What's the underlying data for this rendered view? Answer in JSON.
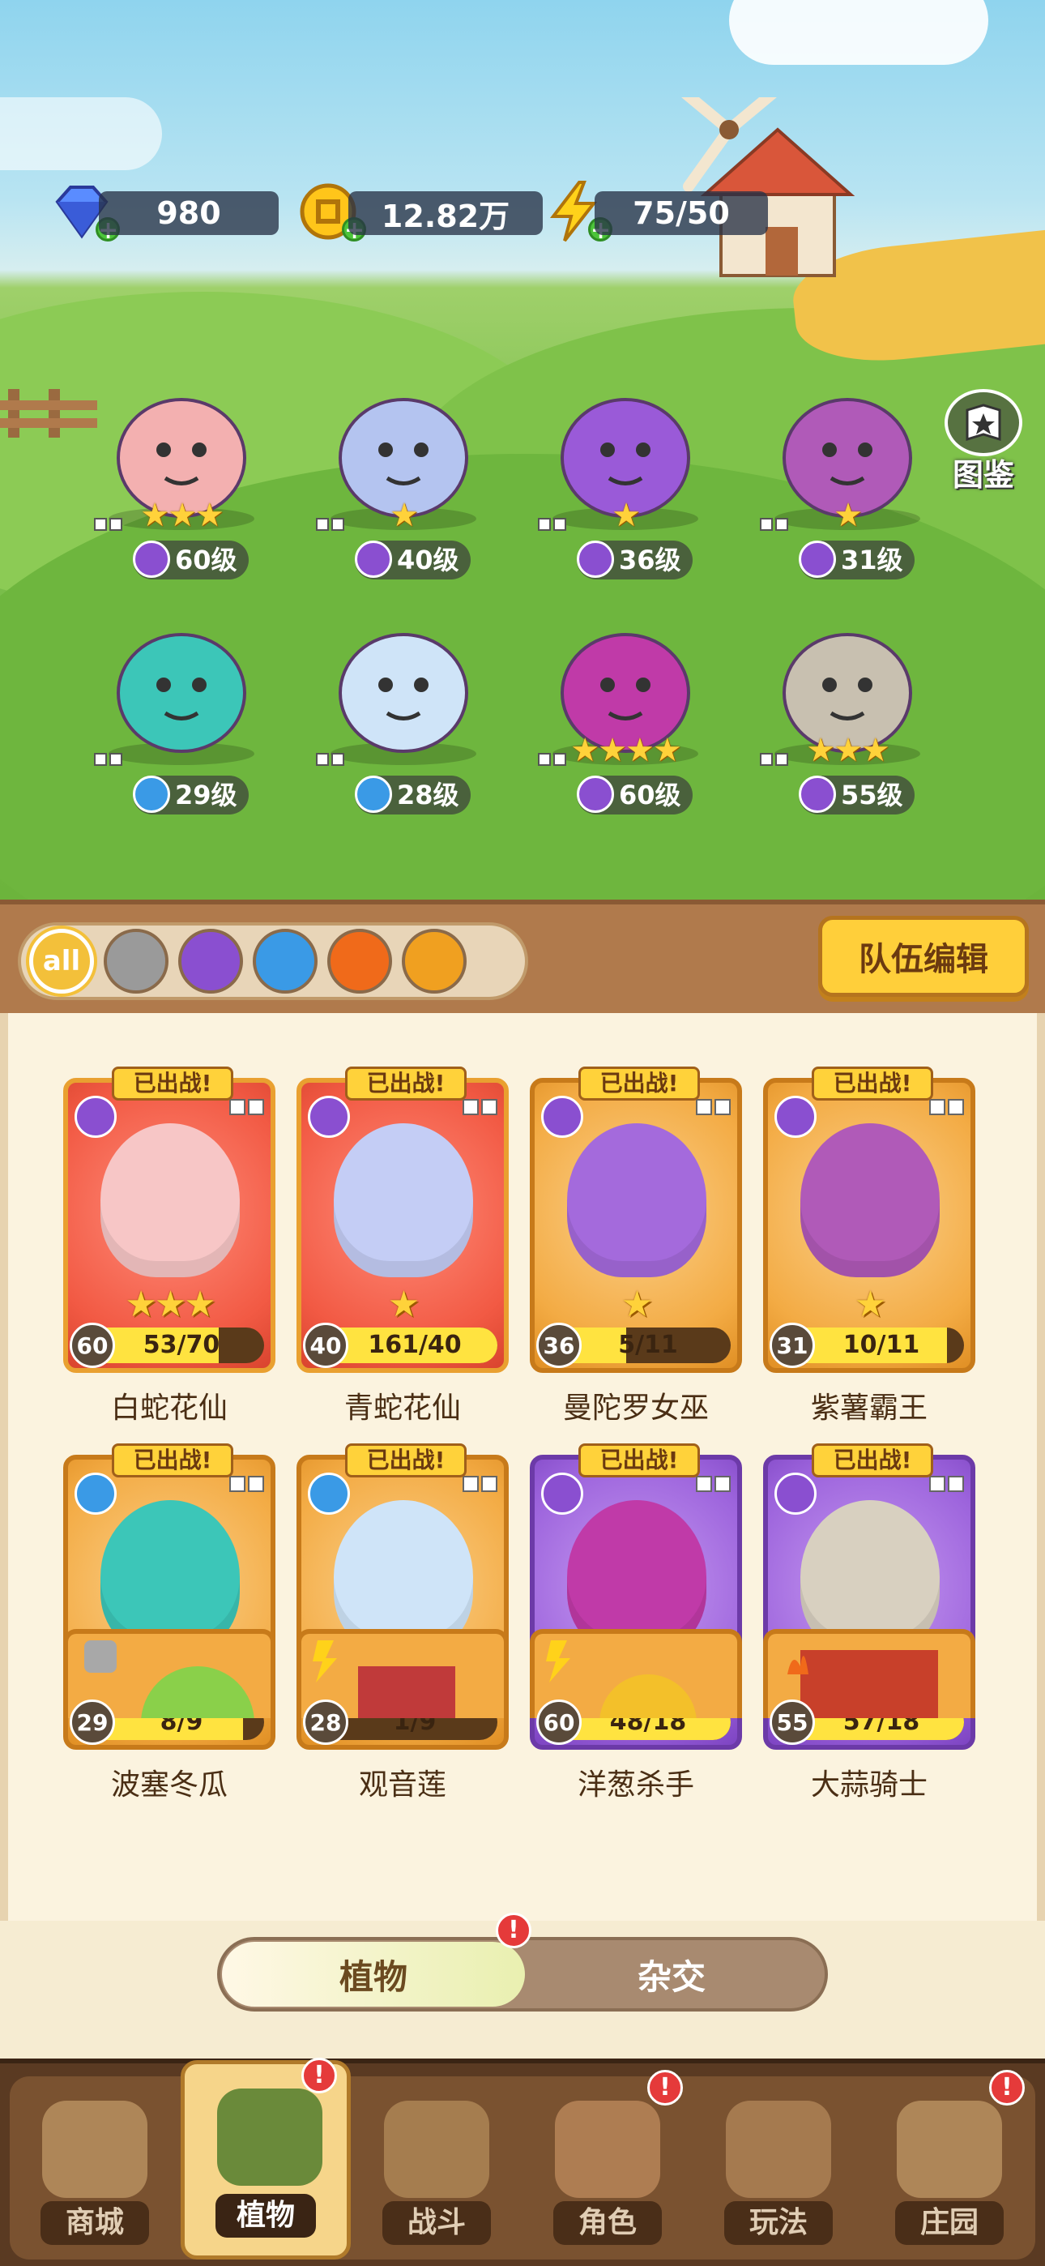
{
  "resources": {
    "gems": "980",
    "coins": "12.82万",
    "energy": "75/50"
  },
  "codex_label": "图鉴",
  "field_team": [
    {
      "level": "60级",
      "stars": 3,
      "element": "purple"
    },
    {
      "level": "40级",
      "stars": 1,
      "element": "purple"
    },
    {
      "level": "36级",
      "stars": 1,
      "element": "purple"
    },
    {
      "level": "31级",
      "stars": 1,
      "element": "purple"
    },
    {
      "level": "29级",
      "stars": 0,
      "element": "water"
    },
    {
      "level": "28级",
      "stars": 0,
      "element": "water"
    },
    {
      "level": "60级",
      "stars": 4,
      "element": "purple"
    },
    {
      "level": "55级",
      "stars": 3,
      "element": "purple"
    }
  ],
  "filters": [
    {
      "id": "all",
      "label": "all",
      "color": "#f3c03a"
    },
    {
      "id": "sword",
      "label": "",
      "color": "#9a9a9a"
    },
    {
      "id": "potion",
      "label": "",
      "color": "#8a4fd0"
    },
    {
      "id": "water",
      "label": "",
      "color": "#3a9ae6"
    },
    {
      "id": "fire",
      "label": "",
      "color": "#f06a1a"
    },
    {
      "id": "lightning",
      "label": "",
      "color": "#f0a020"
    }
  ],
  "team_edit_label": "队伍编辑",
  "deployed_badge": "已出战!",
  "cards": [
    {
      "name": "白蛇花仙",
      "level": "60",
      "progress": "53/70",
      "fill": 0.76,
      "stars": 3,
      "frame": "red",
      "element": "purple",
      "portrait": "#f7c6c6"
    },
    {
      "name": "青蛇花仙",
      "level": "40",
      "progress": "161/40",
      "fill": 1.0,
      "stars": 1,
      "frame": "red",
      "element": "purple",
      "portrait": "#c4cdf5"
    },
    {
      "name": "曼陀罗女巫",
      "level": "36",
      "progress": "5/11",
      "fill": 0.45,
      "stars": 1,
      "frame": "gold",
      "element": "purple",
      "portrait": "#a46adc"
    },
    {
      "name": "紫薯霸王",
      "level": "31",
      "progress": "10/11",
      "fill": 0.91,
      "stars": 1,
      "frame": "gold",
      "element": "purple",
      "portrait": "#b05ab8"
    },
    {
      "name": "波塞冬瓜",
      "level": "29",
      "progress": "8/9",
      "fill": 0.89,
      "stars": 0,
      "frame": "gold",
      "element": "water",
      "portrait": "#3cc6b8"
    },
    {
      "name": "观音莲",
      "level": "28",
      "progress": "1/9",
      "fill": 0.11,
      "stars": 0,
      "frame": "gold",
      "element": "water",
      "portrait": "#cfe4f8"
    },
    {
      "name": "洋葱杀手",
      "level": "60",
      "progress": "48/18",
      "fill": 1.0,
      "stars": 4,
      "frame": "purple",
      "element": "purple",
      "portrait": "#c03aa8"
    },
    {
      "name": "大蒜骑士",
      "level": "55",
      "progress": "57/18",
      "fill": 1.0,
      "stars": 3,
      "frame": "purple",
      "element": "purple",
      "portrait": "#d8d0c0"
    }
  ],
  "segment": {
    "active": "植物",
    "inactive": "杂交",
    "alert": "!"
  },
  "nav": [
    {
      "id": "shop",
      "label": "商城",
      "active": false,
      "alert": false
    },
    {
      "id": "plants",
      "label": "植物",
      "active": true,
      "alert": true
    },
    {
      "id": "battle",
      "label": "战斗",
      "active": false,
      "alert": false
    },
    {
      "id": "character",
      "label": "角色",
      "active": false,
      "alert": true
    },
    {
      "id": "gameplay",
      "label": "玩法",
      "active": false,
      "alert": false
    },
    {
      "id": "manor",
      "label": "庄园",
      "active": false,
      "alert": true
    }
  ]
}
